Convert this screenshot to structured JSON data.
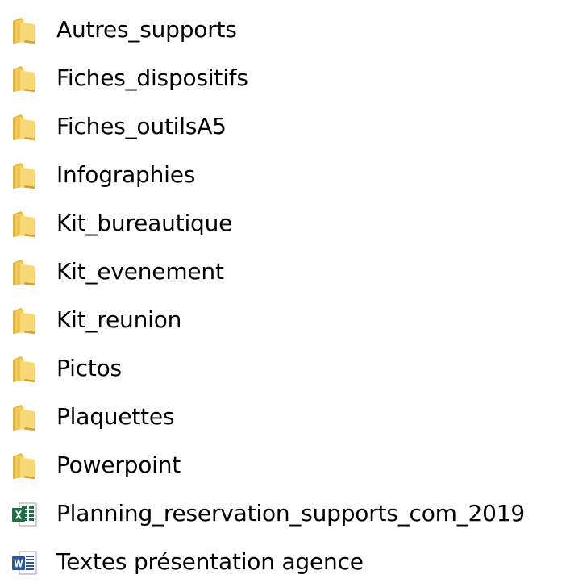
{
  "items": [
    {
      "name": "Autres_supports",
      "icon": "folder-icon"
    },
    {
      "name": "Fiches_dispositifs",
      "icon": "folder-icon"
    },
    {
      "name": "Fiches_outilsA5",
      "icon": "folder-icon"
    },
    {
      "name": "Infographies",
      "icon": "folder-icon"
    },
    {
      "name": "Kit_bureautique",
      "icon": "folder-icon"
    },
    {
      "name": "Kit_evenement",
      "icon": "folder-icon"
    },
    {
      "name": "Kit_reunion",
      "icon": "folder-icon"
    },
    {
      "name": "Pictos",
      "icon": "folder-icon"
    },
    {
      "name": "Plaquettes",
      "icon": "folder-icon"
    },
    {
      "name": "Powerpoint",
      "icon": "folder-icon"
    },
    {
      "name": "Planning_reservation_supports_com_2019",
      "icon": "excel-file-icon"
    },
    {
      "name": "Textes présentation agence",
      "icon": "word-file-icon"
    }
  ],
  "colors": {
    "folder_light": "#F8D775",
    "folder_dark": "#E2B33C",
    "excel_green": "#1E7145",
    "word_blue": "#2B579A"
  }
}
